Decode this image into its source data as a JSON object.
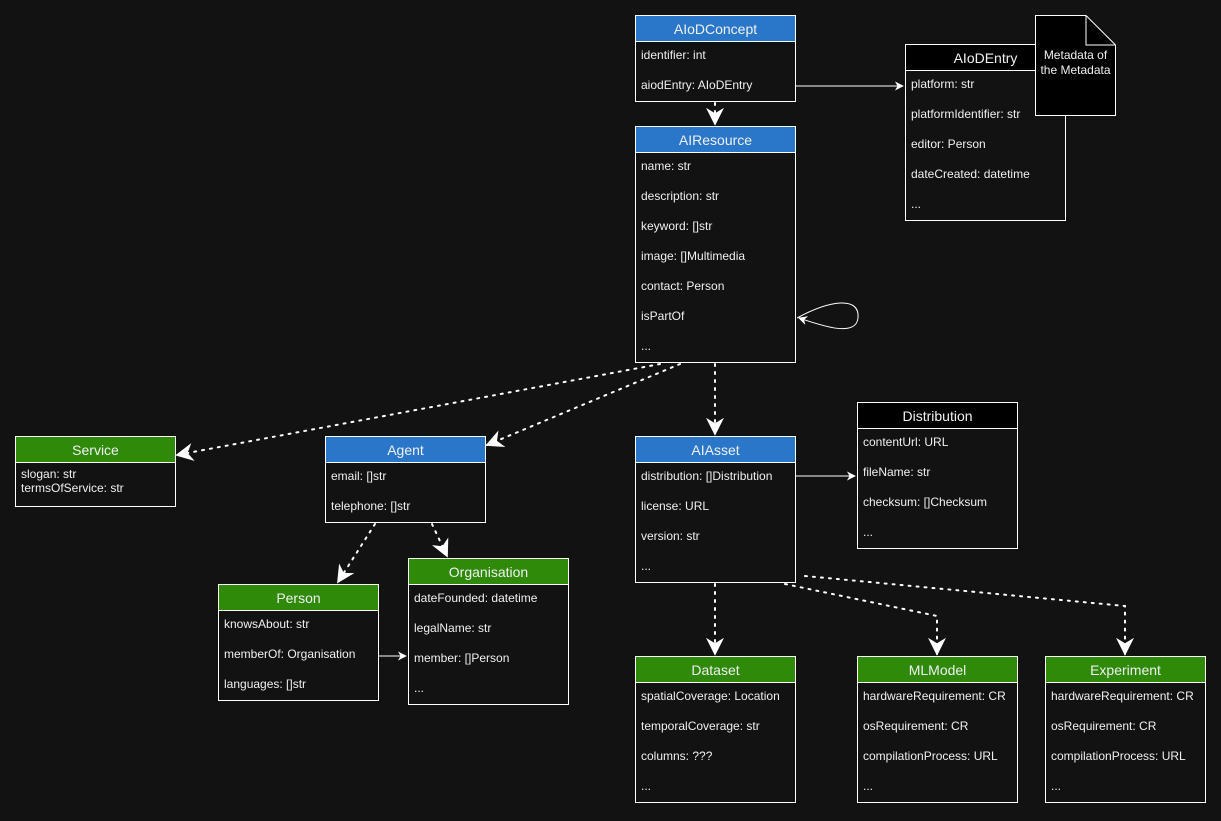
{
  "colors": {
    "background": "#121212",
    "blue_header": "#2a77c9",
    "green_header": "#2e8a08",
    "black_header": "#000000",
    "line": "#ffffff"
  },
  "note": {
    "line1": "Metadata of",
    "line2": "the Metadata"
  },
  "boxes": {
    "aiodconcept": {
      "title": "AIoDConcept",
      "style": "blue",
      "rows": [
        "identifier: int",
        "aiodEntry: AIoDEntry"
      ]
    },
    "aiodentry": {
      "title": "AIoDEntry",
      "style": "black",
      "rows": [
        "platform: str",
        "platformIdentifier: str",
        "editor: Person",
        "dateCreated: datetime",
        "..."
      ]
    },
    "airesource": {
      "title": "AIResource",
      "style": "blue",
      "rows": [
        "name: str",
        "description: str",
        "keyword: []str",
        "image: []Multimedia",
        "contact: Person",
        "isPartOf",
        "..."
      ]
    },
    "service": {
      "title": "Service",
      "style": "green",
      "rows": [
        "slogan: str",
        "termsOfService: str"
      ]
    },
    "agent": {
      "title": "Agent",
      "style": "blue",
      "rows": [
        "email: []str",
        "telephone: []str"
      ]
    },
    "aiasset": {
      "title": "AIAsset",
      "style": "blue",
      "rows": [
        "distribution: []Distribution",
        "license: URL",
        "version: str",
        "..."
      ]
    },
    "distribution": {
      "title": "Distribution",
      "style": "black",
      "rows": [
        "contentUrl: URL",
        "fileName: str",
        "checksum: []Checksum",
        "..."
      ]
    },
    "person": {
      "title": "Person",
      "style": "green",
      "rows": [
        "knowsAbout: str",
        "memberOf: Organisation",
        "languages: []str"
      ]
    },
    "organisation": {
      "title": "Organisation",
      "style": "green",
      "rows": [
        "dateFounded: datetime",
        "legalName: str",
        "member: []Person",
        "..."
      ]
    },
    "dataset": {
      "title": "Dataset",
      "style": "green",
      "rows": [
        "spatialCoverage: Location",
        "temporalCoverage: str",
        "columns: ???",
        "..."
      ]
    },
    "mlmodel": {
      "title": "MLModel",
      "style": "green",
      "rows": [
        "hardwareRequirement: CR",
        "osRequirement: CR",
        "compilationProcess: URL",
        "..."
      ]
    },
    "experiment": {
      "title": "Experiment",
      "style": "green",
      "rows": [
        "hardwareRequirement: CR",
        "osRequirement: CR",
        "compilationProcess: URL",
        "..."
      ]
    }
  }
}
